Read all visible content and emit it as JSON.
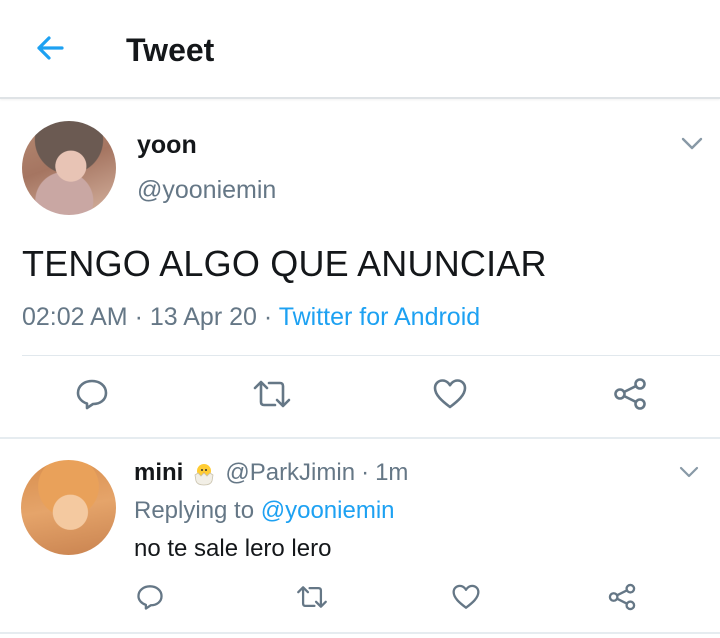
{
  "header": {
    "title": "Tweet",
    "back_icon": "back-arrow-icon"
  },
  "colors": {
    "accent": "#1da1f2",
    "secondary_text": "#657786",
    "primary_text": "#14171a"
  },
  "tweet": {
    "name": "yoon",
    "handle": "@yooniemin",
    "text": "TENGO ALGO QUE ANUNCIAR",
    "time": "02:02 AM",
    "separator": "·",
    "date": "13 Apr 20",
    "source": "Twitter for Android",
    "actions": [
      "reply-icon",
      "retweet-icon",
      "like-icon",
      "share-icon"
    ]
  },
  "reply": {
    "name": "mini",
    "name_emoji": "🐣",
    "handle": "@ParkJimin",
    "separator": "·",
    "time": "1m",
    "replying_prefix": "Replying to",
    "replying_to": "@yooniemin",
    "text": "no te sale lero lero",
    "actions": [
      "reply-icon",
      "retweet-icon",
      "like-icon",
      "share-icon"
    ]
  }
}
